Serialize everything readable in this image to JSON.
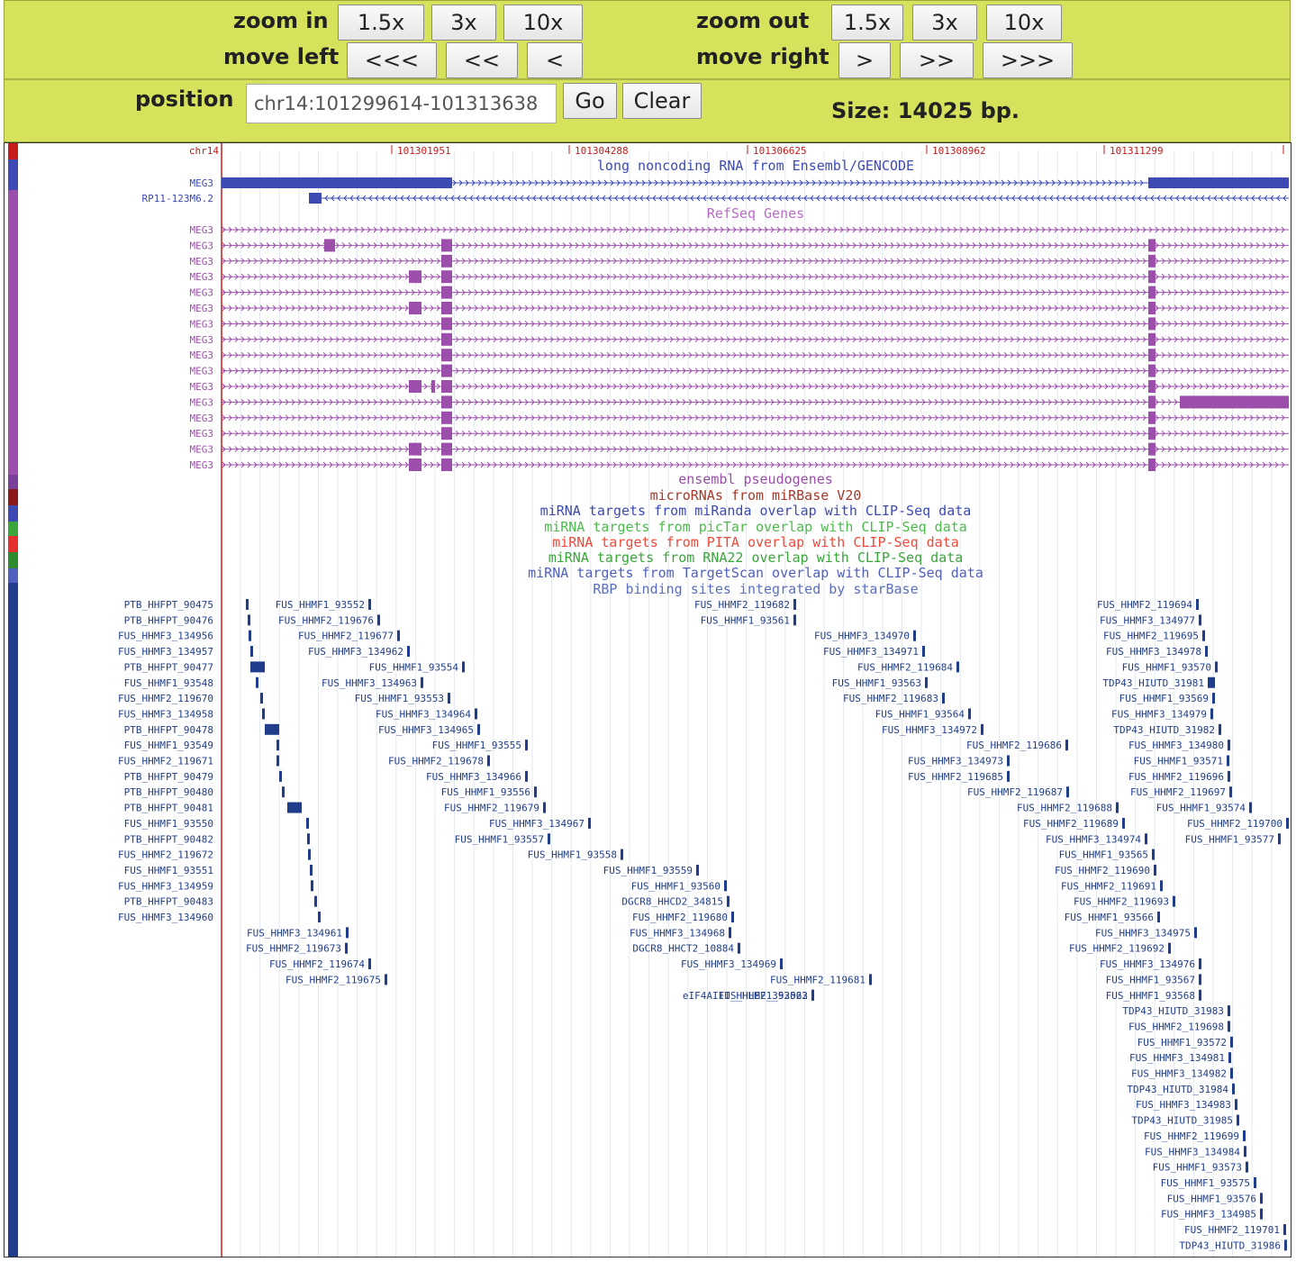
{
  "controls": {
    "zoom_in_label": "zoom in",
    "zoom_out_label": "zoom out",
    "move_left_label": "move left",
    "move_right_label": "move right",
    "position_label": "position",
    "zoom_in_buttons": [
      "1.5x",
      "3x",
      "10x"
    ],
    "zoom_out_buttons": [
      "1.5x",
      "3x",
      "10x"
    ],
    "move_left_buttons": [
      "<<<",
      "<<",
      "<"
    ],
    "move_right_buttons": [
      ">",
      ">>",
      ">>>"
    ],
    "position_value": "chr14:101299614-101313638",
    "go_label": "Go",
    "clear_label": "Clear",
    "size_text": "Size: 14025 bp."
  },
  "ruler": {
    "chrom": "chr14",
    "ticks": [
      "101301951",
      "101304288",
      "101306625",
      "101308962",
      "101311299"
    ]
  },
  "colors": {
    "lnc": "#3d4ab3",
    "refseq": "#9b4eaa",
    "rbp": "#1f3d8a",
    "ruler": "#c51b1b",
    "grid": "#e4e8f0"
  },
  "track_titles": [
    {
      "text": "long noncoding RNA from Ensembl/GENCODE",
      "color": "#3d4ab3"
    },
    {
      "text": "RefSeq Genes",
      "color": "#b86cc8"
    },
    {
      "text": "ensembl pseudogenes",
      "color": "#9b4eaa"
    },
    {
      "text": "microRNAs from miRBase V20",
      "color": "#a33a2a"
    },
    {
      "text": "miRNA targets from miRanda overlap with CLIP-Seq data",
      "color": "#3d4ab3"
    },
    {
      "text": "miRNA targets from picTar overlap with CLIP-Seq data",
      "color": "#4bbb4b"
    },
    {
      "text": "miRNA targets from PITA overlap with CLIP-Seq data",
      "color": "#ec4a3a"
    },
    {
      "text": "miRNA targets from RNA22 overlap with CLIP-Seq data",
      "color": "#3aa63a"
    },
    {
      "text": "miRNA targets from TargetScan overlap with CLIP-Seq data",
      "color": "#5060c0"
    },
    {
      "text": "RBP binding sites integrated by starBase",
      "color": "#5a6fc0"
    }
  ],
  "lnc_genes": [
    "MEG3",
    "RP11-123M6.2"
  ],
  "refseq_gene": "MEG3",
  "refseq_count": 16,
  "rbp_left_labels": [
    "PTB_HHFPT_90475",
    "PTB_HHFPT_90476",
    "FUS_HHMF3_134956",
    "FUS_HHMF3_134957",
    "PTB_HHFPT_90477",
    "FUS_HHMF1_93548",
    "FUS_HHMF2_119670",
    "FUS_HHMF3_134958",
    "PTB_HHFPT_90478",
    "FUS_HHMF1_93549",
    "FUS_HHMF2_119671",
    "PTB_HHFPT_90479",
    "PTB_HHFPT_90480",
    "PTB_HHFPT_90481",
    "FUS_HHMF1_93550",
    "PTB_HHFPT_90482",
    "FUS_HHMF2_119672",
    "FUS_HHMF1_93551",
    "FUS_HHMF3_134959",
    "PTB_HHFPT_90483",
    "FUS_HHMF3_134960"
  ],
  "rbp_items": [
    [
      "FUS_HHMF1_93552",
      0
    ],
    [
      "FUS_HHMF2_119676",
      1
    ],
    [
      "FUS_HHMF2_119677",
      2
    ],
    [
      "FUS_HHMF3_134962",
      3
    ],
    [
      "FUS_HHMF1_93554",
      4
    ],
    [
      "FUS_HHMF3_134963",
      5
    ],
    [
      "FUS_HHMF1_93553",
      6
    ],
    [
      "FUS_HHMF3_134964",
      7
    ],
    [
      "FUS_HHMF3_134965",
      8
    ],
    [
      "FUS_HHMF1_93555",
      9
    ],
    [
      "FUS_HHMF2_119678",
      10
    ],
    [
      "FUS_HHMF3_134966",
      11
    ],
    [
      "FUS_HHMF1_93556",
      12
    ],
    [
      "FUS_HHMF2_119679",
      13
    ],
    [
      "FUS_HHMF3_134967",
      14
    ],
    [
      "FUS_HHMF1_93557",
      15
    ],
    [
      "FUS_HHMF1_93558",
      16
    ],
    [
      "FUS_HHMF1_93559",
      17
    ],
    [
      "FUS_HHMF1_93560",
      18
    ],
    [
      "DGCR8_HHCD2_34815",
      19
    ],
    [
      "FUS_HHMF2_119680",
      20
    ],
    [
      "FUS_HHMF3_134961",
      21
    ],
    [
      "FUS_HHMF3_134968",
      21
    ],
    [
      "FUS_HHMF2_119673",
      22
    ],
    [
      "DGCR8_HHCT2_10884",
      22
    ],
    [
      "FUS_HHMF2_119674",
      23
    ],
    [
      "FUS_HHMF3_134969",
      23
    ],
    [
      "FUS_HHMF2_119675",
      24
    ],
    [
      "FUS_HHMF2_119681",
      24
    ],
    [
      "eIF4AIII_HHLE2_352023",
      25
    ],
    [
      "FUS_HHMF1_93562",
      25
    ],
    [
      "FUS_HHMF2_119682",
      0
    ],
    [
      "FUS_HHMF1_93561",
      1
    ],
    [
      "FUS_HHMF3_134970",
      2
    ],
    [
      "FUS_HHMF3_134971",
      3
    ],
    [
      "FUS_HHMF2_119684",
      4
    ],
    [
      "FUS_HHMF1_93563",
      5
    ],
    [
      "FUS_HHMF2_119683",
      6
    ],
    [
      "FUS_HHMF1_93564",
      7
    ],
    [
      "FUS_HHMF3_134972",
      8
    ],
    [
      "FUS_HHMF2_119686",
      9
    ],
    [
      "FUS_HHMF3_134973",
      10
    ],
    [
      "FUS_HHMF2_119685",
      11
    ],
    [
      "FUS_HHMF2_119687",
      12
    ],
    [
      "FUS_HHMF2_119688",
      13
    ],
    [
      "FUS_HHMF2_119689",
      14
    ],
    [
      "FUS_HHMF3_134974",
      15
    ],
    [
      "FUS_HHMF2_119694",
      0
    ],
    [
      "FUS_HHMF3_134977",
      1
    ],
    [
      "FUS_HHMF2_119695",
      2
    ],
    [
      "FUS_HHMF3_134978",
      3
    ],
    [
      "FUS_HHMF1_93570",
      4
    ],
    [
      "TDP43_HIUTD_31981",
      5
    ],
    [
      "FUS_HHMF1_93569",
      6
    ],
    [
      "FUS_HHMF3_134979",
      7
    ],
    [
      "TDP43_HIUTD_31982",
      8
    ],
    [
      "FUS_HHMF3_134980",
      9
    ],
    [
      "FUS_HHMF1_93571",
      10
    ],
    [
      "FUS_HHMF2_119696",
      11
    ],
    [
      "FUS_HHMF2_119697",
      12
    ],
    [
      "FUS_HHMF1_93574",
      13
    ],
    [
      "FUS_HHMF2_119700",
      14
    ],
    [
      "FUS_HHMF1_93577",
      15
    ],
    [
      "FUS_HHMF1_93565",
      16
    ],
    [
      "FUS_HHMF2_119690",
      17
    ],
    [
      "FUS_HHMF2_119691",
      18
    ],
    [
      "FUS_HHMF2_119693",
      19
    ],
    [
      "FUS_HHMF1_93566",
      20
    ],
    [
      "FUS_HHMF3_134975",
      21
    ],
    [
      "FUS_HHMF2_119692",
      22
    ],
    [
      "FUS_HHMF3_134976",
      23
    ],
    [
      "FUS_HHMF1_93567",
      24
    ],
    [
      "FUS_HHMF1_93568",
      25
    ],
    [
      "TDP43_HIUTD_31983",
      26
    ],
    [
      "FUS_HHMF2_119698",
      27
    ],
    [
      "FUS_HHMF1_93572",
      28
    ],
    [
      "FUS_HHMF3_134981",
      29
    ],
    [
      "FUS_HHMF3_134982",
      30
    ],
    [
      "TDP43_HIUTD_31984",
      31
    ],
    [
      "FUS_HHMF3_134983",
      32
    ],
    [
      "TDP43_HIUTD_31985",
      33
    ],
    [
      "FUS_HHMF2_119699",
      34
    ],
    [
      "FUS_HHMF3_134984",
      35
    ],
    [
      "FUS_HHMF1_93573",
      36
    ],
    [
      "FUS_HHMF1_93575",
      37
    ],
    [
      "FUS_HHMF1_93576",
      38
    ],
    [
      "FUS_HHMF3_134985",
      39
    ],
    [
      "FUS_HHMF2_119701",
      40
    ],
    [
      "TDP43_HIUTD_31986",
      41
    ]
  ]
}
